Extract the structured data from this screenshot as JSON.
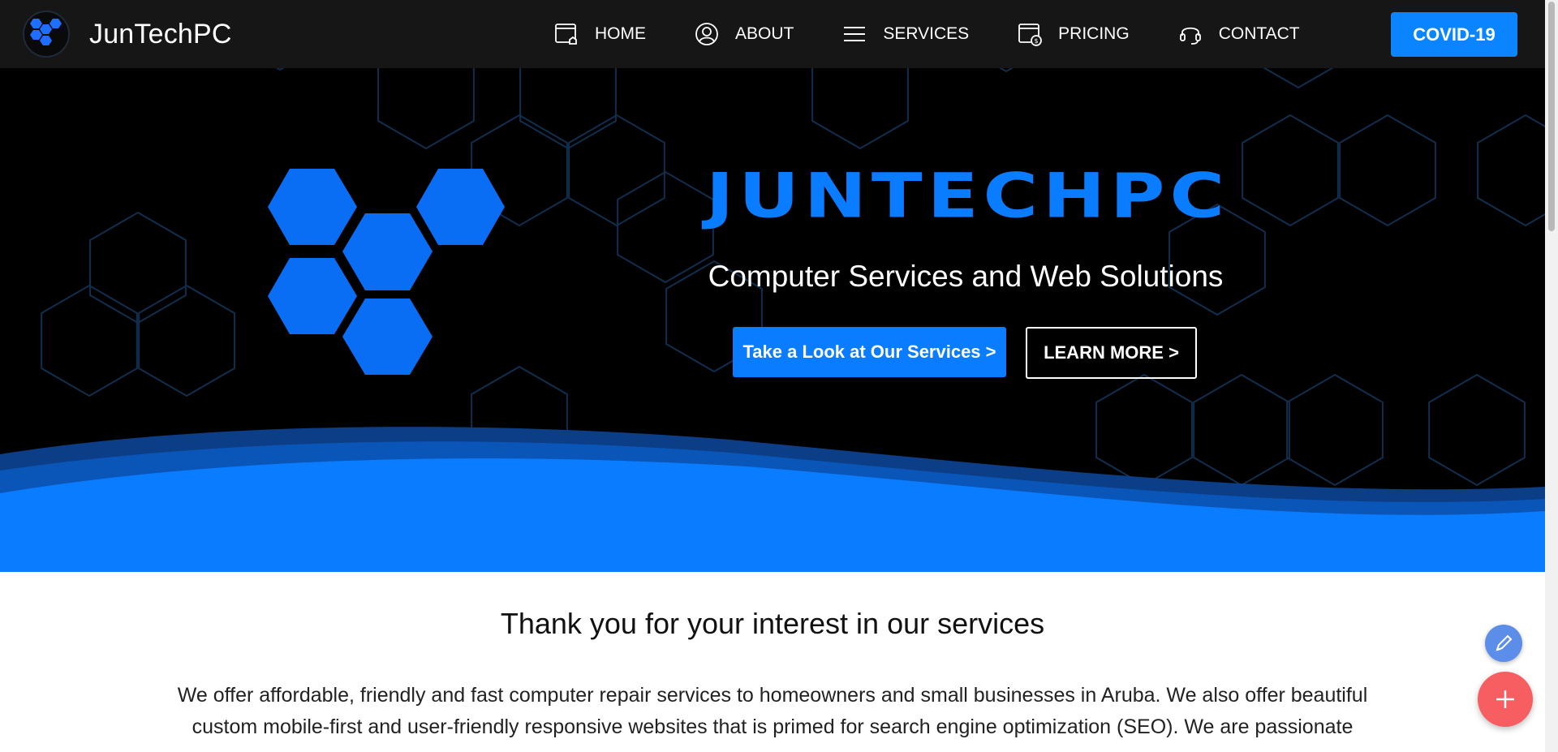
{
  "brand": {
    "name": "JunTechPC"
  },
  "nav": {
    "items": [
      {
        "label": "HOME",
        "icon": "home-icon"
      },
      {
        "label": "ABOUT",
        "icon": "user-icon"
      },
      {
        "label": "SERVICES",
        "icon": "menu-icon"
      },
      {
        "label": "PRICING",
        "icon": "pricing-icon"
      },
      {
        "label": "CONTACT",
        "icon": "headset-icon"
      }
    ],
    "covid_label": "COVID-19"
  },
  "hero": {
    "title": "JUNTECHPC",
    "subtitle": "Computer Services and Web Solutions",
    "primary_button": "Take a Look at Our Services >",
    "secondary_button": "LEARN MORE >"
  },
  "content": {
    "heading": "Thank you for your interest in our services",
    "body": "We offer affordable, friendly and fast computer repair services to homeowners and small businesses in Aruba. We also offer beautiful custom mobile-first and user-friendly responsive websites that is primed for search engine optimization (SEO). We are passionate"
  },
  "colors": {
    "accent": "#0a7cff",
    "nav_bg": "#161616",
    "fab_edit": "#5c8de8",
    "fab_add": "#f65e62"
  },
  "floating": {
    "edit_icon": "pencil-icon",
    "add_icon": "plus-icon"
  }
}
